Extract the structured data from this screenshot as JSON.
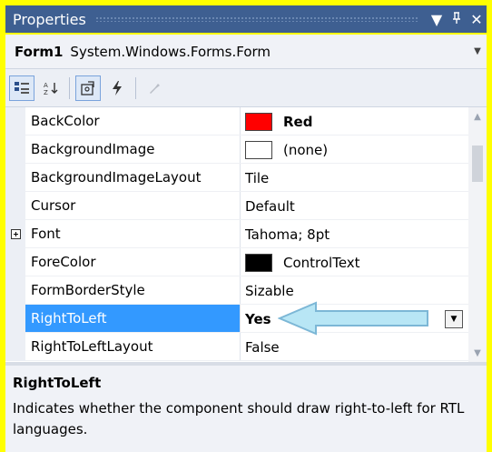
{
  "window": {
    "title": "Properties",
    "dropdown_icon": "▼",
    "pin_icon": "ᒃ",
    "close_icon": "✕"
  },
  "object_selector": {
    "name": "Form1",
    "type": "System.Windows.Forms.Form"
  },
  "toolbar": {
    "buttons": [
      "categorized-icon",
      "alphabetical-icon",
      "properties-icon",
      "events-icon",
      "property-pages-icon"
    ]
  },
  "properties": [
    {
      "name": "BackColor",
      "value": "Red",
      "swatch": "#ff0000",
      "bold": true
    },
    {
      "name": "BackgroundImage",
      "value": "(none)",
      "swatch": "#ffffff"
    },
    {
      "name": "BackgroundImageLayout",
      "value": "Tile"
    },
    {
      "name": "Cursor",
      "value": "Default"
    },
    {
      "name": "Font",
      "value": "Tahoma; 8pt",
      "expandable": true
    },
    {
      "name": "ForeColor",
      "value": "ControlText",
      "swatch": "#000000"
    },
    {
      "name": "FormBorderStyle",
      "value": "Sizable"
    },
    {
      "name": "RightToLeft",
      "value": "Yes",
      "selected": true,
      "bold": true
    },
    {
      "name": "RightToLeftLayout",
      "value": "False"
    }
  ],
  "description": {
    "title": "RightToLeft",
    "text": "Indicates whether the component should draw right-to-left for RTL languages."
  },
  "colors": {
    "background": "#ffff00",
    "titlebar": "#3e5f91",
    "selection": "#3399ff",
    "arrow": "#a9dff0"
  }
}
